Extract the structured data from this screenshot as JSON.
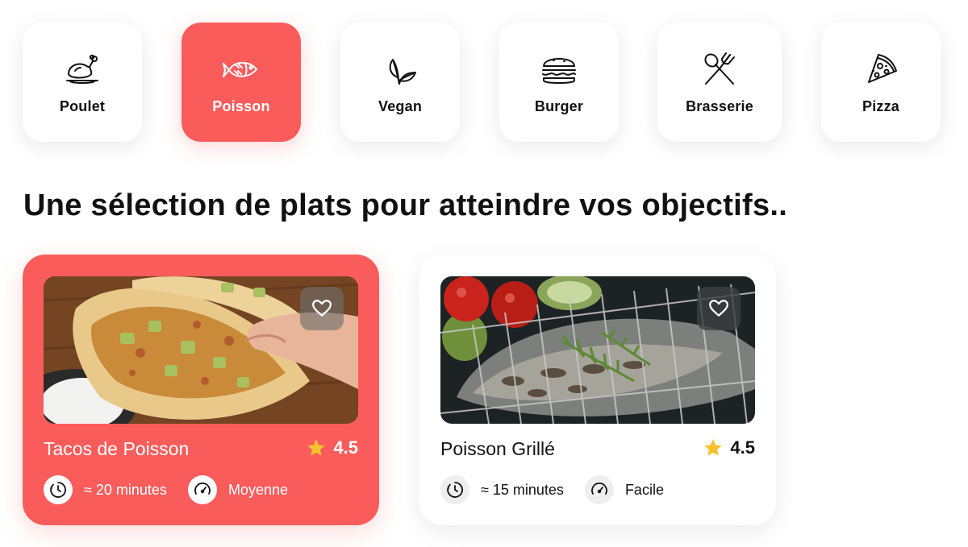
{
  "categories": [
    {
      "label": "Poulet",
      "icon": "chicken-icon",
      "active": false
    },
    {
      "label": "Poisson",
      "icon": "fish-icon",
      "active": true
    },
    {
      "label": "Vegan",
      "icon": "leaf-icon",
      "active": false
    },
    {
      "label": "Burger",
      "icon": "burger-icon",
      "active": false
    },
    {
      "label": "Brasserie",
      "icon": "cutlery-icon",
      "active": false
    },
    {
      "label": "Pizza",
      "icon": "pizza-slice-icon",
      "active": false
    }
  ],
  "section": {
    "title": "Une sélection de plats pour atteindre vos objectifs.."
  },
  "dishes": [
    {
      "title": "Tacos de Poisson",
      "rating": "4.5",
      "time": "≈ 20 minutes",
      "difficulty": "Moyenne",
      "active": true,
      "image": "fish-tacos-photo",
      "favorite_icon": "heart-outline-icon"
    },
    {
      "title": "Poisson Grillé",
      "rating": "4.5",
      "time": "≈ 15 minutes",
      "difficulty": "Facile",
      "active": false,
      "image": "grilled-fish-photo",
      "favorite_icon": "heart-outline-icon"
    }
  ],
  "colors": {
    "accent": "#fa5c5b",
    "star": "#fbc02d",
    "text": "#111111",
    "card": "#ffffff"
  }
}
